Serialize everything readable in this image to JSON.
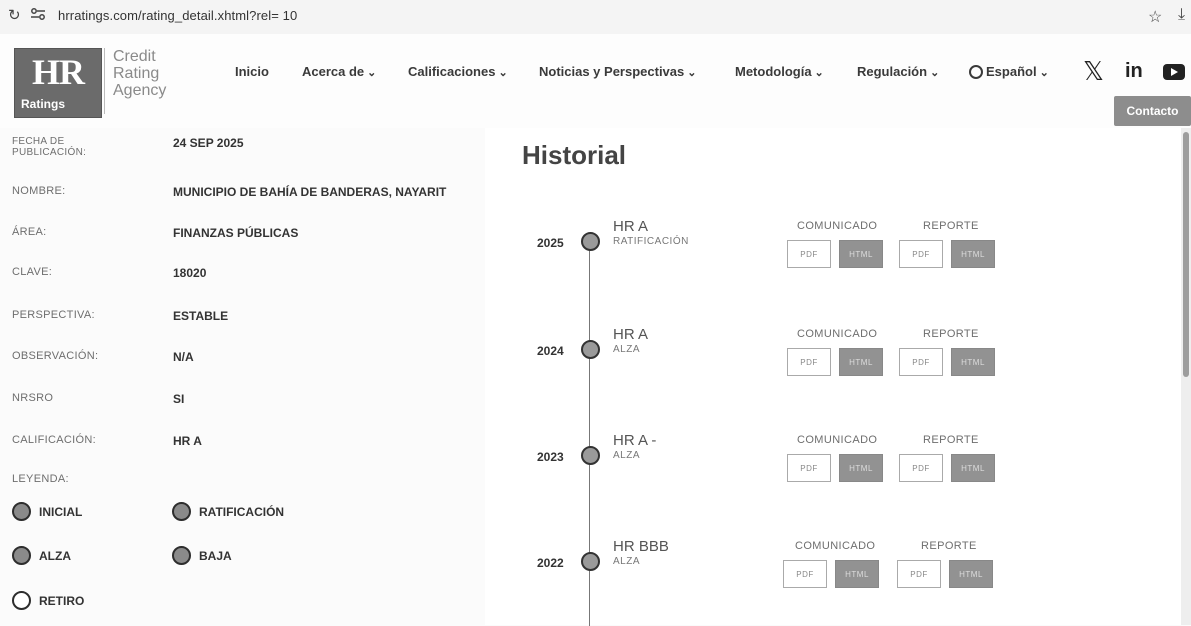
{
  "browser": {
    "url": "hrratings.com/rating_detail.xhtml?rel= 10"
  },
  "header": {
    "logo_main": "HR",
    "logo_sub": "Ratings",
    "agency_lines": [
      "Credit",
      "Rating",
      "Agency"
    ],
    "nav": [
      {
        "label": "Inicio",
        "dropdown": false
      },
      {
        "label": "Acerca de",
        "dropdown": true
      },
      {
        "label": "Calificaciones",
        "dropdown": true
      },
      {
        "label": "Noticias y Perspectivas",
        "dropdown": true
      },
      {
        "label": "Metodología",
        "dropdown": true
      },
      {
        "label": "Regulación",
        "dropdown": true
      },
      {
        "label": "Español",
        "dropdown": true
      }
    ],
    "social": {
      "x": "𝕏",
      "linkedin": "in"
    },
    "contact_label": "Contacto"
  },
  "info": {
    "rows": [
      {
        "label": "FECHA DE PUBLICACIÓN:",
        "value": "24 SEP 2025"
      },
      {
        "label": "NOMBRE:",
        "value": "MUNICIPIO DE BAHÍA DE BANDERAS, NAYARIT"
      },
      {
        "label": "ÁREA:",
        "value": "FINANZAS PÚBLICAS"
      },
      {
        "label": "CLAVE:",
        "value": "18020"
      },
      {
        "label": "PERSPECTIVA:",
        "value": "ESTABLE"
      },
      {
        "label": "OBSERVACIÓN:",
        "value": "N/A"
      },
      {
        "label": "NRSRO",
        "value": "SI"
      },
      {
        "label": "CALIFICACIÓN:",
        "value": "HR A"
      }
    ],
    "legend_label": "LEYENDA:",
    "legend": {
      "inicial": "INICIAL",
      "ratificacion": "RATIFICACIÓN",
      "alza": "ALZA",
      "baja": "BAJA",
      "retiro": "RETIRO"
    }
  },
  "historial": {
    "title": "Historial",
    "comunicado_label": "COMUNICADO",
    "reporte_label": "REPORTE",
    "pdf_label": "PDF",
    "html_label": "HTML",
    "entries": [
      {
        "year": "2025",
        "rating": "HR A",
        "action": "RATIFICACIÓN"
      },
      {
        "year": "2024",
        "rating": "HR A",
        "action": "ALZA"
      },
      {
        "year": "2023",
        "rating": "HR A -",
        "action": "ALZA"
      },
      {
        "year": "2022",
        "rating": "HR BBB",
        "action": "ALZA"
      }
    ]
  }
}
